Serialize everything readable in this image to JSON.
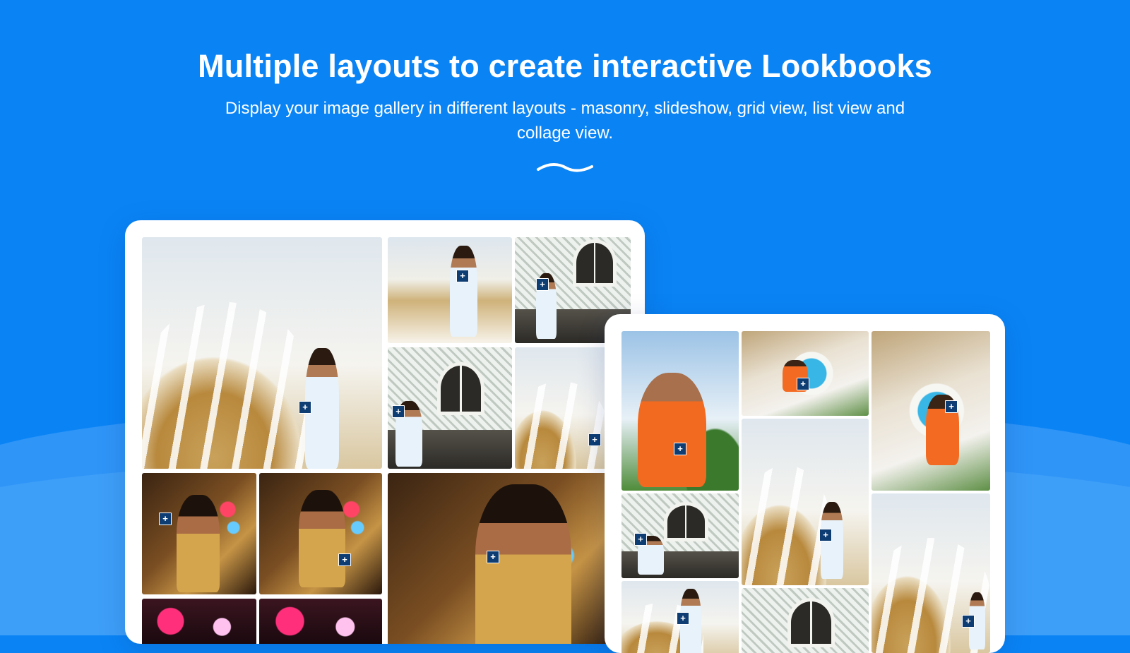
{
  "hero": {
    "title": "Multiple layouts to create interactive Lookbooks",
    "subtitle": "Display your image gallery in different layouts - masonry, slideshow, grid view, list view and collage view."
  },
  "colors": {
    "background": "#0a84f5",
    "wave": "#3f9cf6",
    "card": "#ffffff",
    "hotspot": "#0d3d73"
  },
  "hotspot_icon": "plus-icon",
  "hotspot_glyph": "+",
  "gallery_masonry": {
    "tiles": [
      {
        "photo": "dome-white-dress"
      },
      {
        "photo": "stairs-white-dress"
      },
      {
        "photo": "lattice-window-seated"
      },
      {
        "photo": "lattice-window-seated"
      },
      {
        "photo": "dome-closeup"
      },
      {
        "photo": "gold-dress-mirror-room"
      },
      {
        "photo": "gold-dress-lights"
      },
      {
        "photo": "gold-dress-portrait"
      },
      {
        "photo": "party-lights"
      },
      {
        "photo": "party-lights"
      }
    ]
  },
  "gallery_collage": {
    "tiles": [
      {
        "photo": "orange-dress-sky"
      },
      {
        "photo": "orange-dress-pool"
      },
      {
        "photo": "orange-dress-pool-terrace"
      },
      {
        "photo": "lattice-window-seated"
      },
      {
        "photo": "dome-white-dress"
      },
      {
        "photo": "dome-closeup"
      },
      {
        "photo": "dome-white-dress"
      },
      {
        "photo": "lattice-window"
      }
    ]
  }
}
